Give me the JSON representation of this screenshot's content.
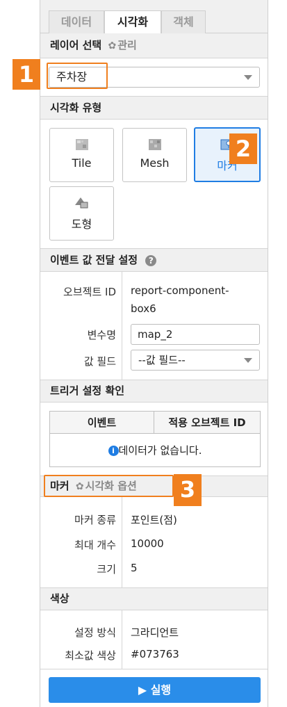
{
  "tabs": [
    {
      "label": "데이터",
      "active": false
    },
    {
      "label": "시각화",
      "active": true
    },
    {
      "label": "객체",
      "active": false
    }
  ],
  "layer": {
    "title": "레이어 선택",
    "manage_label": "관리",
    "selected": "주차장"
  },
  "viz_type": {
    "title": "시각화 유형",
    "options": [
      {
        "label": "Tile",
        "icon": "tile-icon",
        "active": false
      },
      {
        "label": "Mesh",
        "icon": "mesh-icon",
        "active": false
      },
      {
        "label": "마커",
        "icon": "marker-icon",
        "active": true
      },
      {
        "label": "도형",
        "icon": "shape-icon",
        "active": false
      }
    ]
  },
  "event": {
    "title": "이벤트 값 전달 설정",
    "object_id_label": "오브젝트 ID",
    "object_id_value_line1": "report-component-",
    "object_id_value_line2": "box6",
    "var_label": "변수명",
    "var_value": "map_2",
    "field_label": "값 필드",
    "field_value": "--값 필드--"
  },
  "trigger": {
    "title": "트리거 설정 확인",
    "col1": "이벤트",
    "col2": "적용 오브젝트 ID",
    "empty": "데이터가 없습니다."
  },
  "marker": {
    "title": "마커",
    "options_label": "시각화 옵션",
    "type_label": "마커 종류",
    "type_value": "포인트(점)",
    "max_label": "최대 개수",
    "max_value": "10000",
    "size_label": "크기",
    "size_value": "5"
  },
  "color": {
    "title": "색상",
    "method_label": "설정 방식",
    "method_value": "그라디언트",
    "min_label": "최소값 색상",
    "min_value": "#073763"
  },
  "run_label": "▶ 실행",
  "badges": [
    "1",
    "2",
    "3"
  ],
  "colors": {
    "accent": "#1f7de3",
    "run": "#2a8de9",
    "badge": "#f07f1e"
  }
}
